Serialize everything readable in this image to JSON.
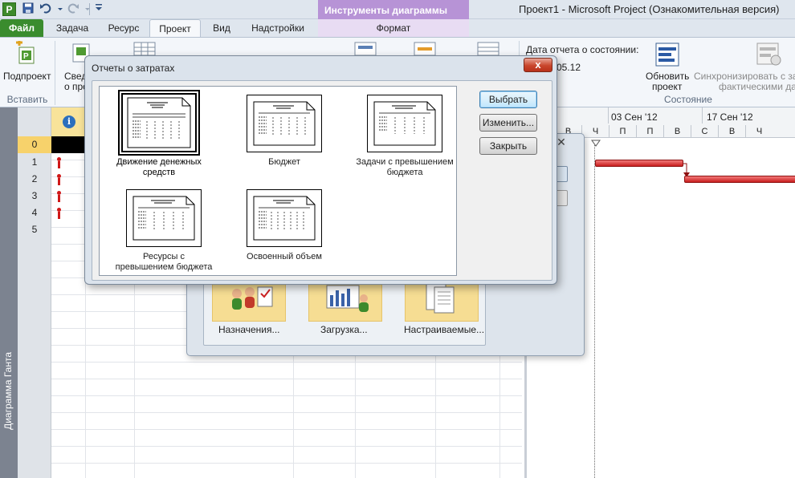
{
  "titlebar": {
    "app_icon_letter": "P",
    "window_title": "Проект1  -  Microsoft Project (Ознакомительная версия)",
    "contextual_tab_group": "Инструменты диаграммы Ганта"
  },
  "ribbon_tabs": [
    {
      "label": "Файл"
    },
    {
      "label": "Задача"
    },
    {
      "label": "Ресурс"
    },
    {
      "label": "Проект"
    },
    {
      "label": "Вид"
    },
    {
      "label": "Надстройки"
    },
    {
      "label": "Формат"
    }
  ],
  "ribbon": {
    "subproject_label": "Подпроект",
    "insert_group_label": "Вставить",
    "partial_label_1": "Свед",
    "partial_label_2": "о проек",
    "status_date_label": "Дата отчета о состоянии:",
    "status_date_value": "05.12",
    "update_project_label_1": "Обновить",
    "update_project_label_2": "проект",
    "sync_label_1": "Синхронизировать с зап",
    "sync_label_2": "фактическими дан",
    "status_group_label": "Состояние"
  },
  "view_bar": {
    "label": "Диаграмма Ганта"
  },
  "grid": {
    "row_numbers": [
      "0",
      "1",
      "2",
      "3",
      "4",
      "5"
    ]
  },
  "gantt": {
    "week1": "03 Сен '12",
    "week2": "17 Сен '12",
    "days": [
      "В",
      "Ч",
      "П",
      "П",
      "В",
      "С",
      "В",
      "Ч"
    ]
  },
  "background_dialog": {
    "tiles": [
      {
        "label": "Назначения..."
      },
      {
        "label": "Загрузка..."
      },
      {
        "label": "Настраиваемые..."
      }
    ]
  },
  "dialog": {
    "title": "Отчеты о затратах",
    "close_glyph": "x",
    "reports": [
      {
        "label_line1": "Движение денежных",
        "label_line2": "средств"
      },
      {
        "label_line1": "Бюджет",
        "label_line2": ""
      },
      {
        "label_line1": "Задачи с превышением",
        "label_line2": "бюджета"
      },
      {
        "label_line1": "Ресурсы с",
        "label_line2": "превышением бюджета"
      },
      {
        "label_line1": "Освоенный объем",
        "label_line2": ""
      }
    ],
    "buttons": {
      "select": "Выбрать",
      "edit": "Изменить...",
      "close": "Закрыть"
    }
  }
}
